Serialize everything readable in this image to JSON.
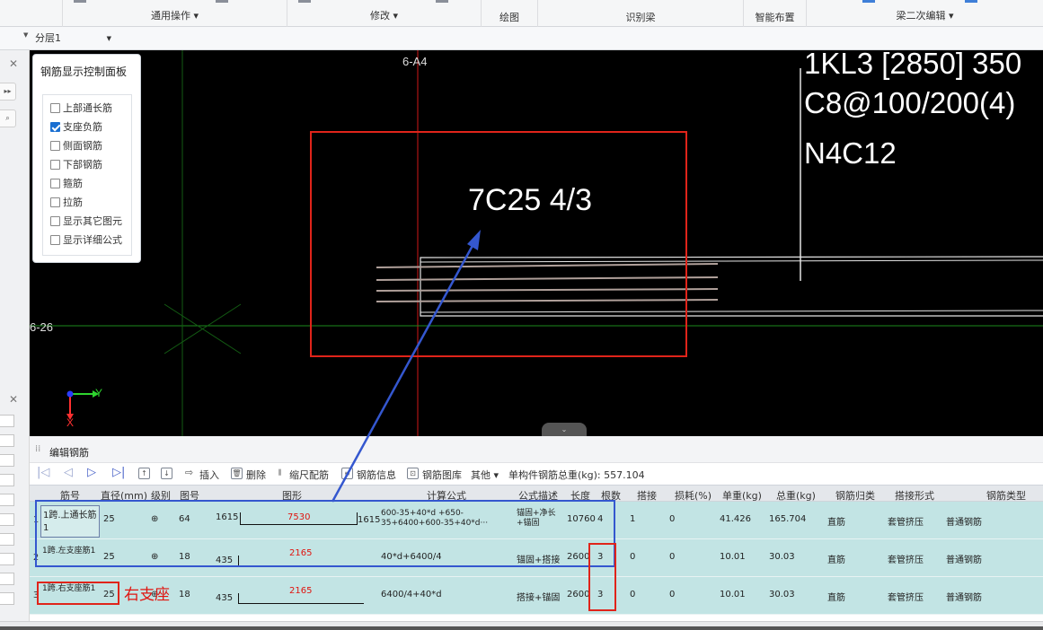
{
  "ribbon": {
    "groups": [
      {
        "label": "通用操作 ▾"
      },
      {
        "label": "修改 ▾"
      },
      {
        "label": "绘图"
      },
      {
        "label": "识别梁"
      },
      {
        "label": "智能布置"
      },
      {
        "label": "梁二次编辑 ▾"
      }
    ]
  },
  "subbar": {
    "layer": "分层1"
  },
  "canvas": {
    "annotation": "7C25 4/3",
    "beam_label_1": "1KL3 [2850] 350",
    "beam_label_2": "C8@100/200(4)",
    "beam_label_3": "N4C12",
    "axis_top": "6-A4",
    "axis_left": "6-26",
    "axis_y": "Y",
    "axis_x": "X",
    "collapse": "⌄"
  },
  "control_panel": {
    "title": "钢筋显示控制面板",
    "items": [
      {
        "label": "上部通长筋",
        "checked": false
      },
      {
        "label": "支座负筋",
        "checked": true
      },
      {
        "label": "侧面钢筋",
        "checked": false
      },
      {
        "label": "下部钢筋",
        "checked": false
      },
      {
        "label": "箍筋",
        "checked": false
      },
      {
        "label": "拉筋",
        "checked": false
      },
      {
        "label": "显示其它图元",
        "checked": false
      },
      {
        "label": "显示详细公式",
        "checked": false
      }
    ]
  },
  "edit_panel": {
    "title": "编辑钢筋",
    "toolbar": {
      "insert": "插入",
      "delete": "删除",
      "scale": "缩尺配筋",
      "info": "钢筋信息",
      "library": "钢筋图库",
      "other": "其他 ▾",
      "total": "单构件钢筋总重(kg): 557.104"
    },
    "columns": [
      "筋号",
      "直径(mm)",
      "级别",
      "图号",
      "图形",
      "计算公式",
      "公式描述",
      "长度",
      "根数",
      "搭接",
      "损耗(%)",
      "单重(kg)",
      "总重(kg)",
      "钢筋归类",
      "搭接形式",
      "钢筋类型"
    ],
    "rows": [
      {
        "num": "1",
        "name": "1跨.上通长筋1",
        "dia": "25",
        "grade": "⊕",
        "fig": "64",
        "shape_left": "1615",
        "shape_mid": "7530",
        "shape_right": "1615",
        "formula": "600-35+40*d +650-35+6400+600-35+40*d···",
        "desc": "锚固+净长+锚固",
        "length": "10760",
        "count": "4",
        "lap": "1",
        "loss": "0",
        "unit_w": "41.426",
        "total_w": "165.704",
        "class": "直筋",
        "lap_type": "套管挤压",
        "type": "普通钢筋"
      },
      {
        "num": "2",
        "name": "1跨.左支座筋1",
        "dia": "25",
        "grade": "⊕",
        "fig": "18",
        "shape_left": "435",
        "shape_mid": "2165",
        "shape_right": "",
        "formula": "40*d+6400/4",
        "desc": "锚固+搭接",
        "length": "2600",
        "count": "3",
        "lap": "0",
        "loss": "0",
        "unit_w": "10.01",
        "total_w": "30.03",
        "class": "直筋",
        "lap_type": "套管挤压",
        "type": "普通钢筋"
      },
      {
        "num": "3",
        "name": "1跨.右支座筋1",
        "dia": "25",
        "grade": "⊕",
        "fig": "18",
        "shape_left": "435",
        "shape_mid": "2165",
        "shape_right": "",
        "formula": "6400/4+40*d",
        "desc": "搭接+锚固",
        "length": "2600",
        "count": "3",
        "lap": "0",
        "loss": "0",
        "unit_w": "10.01",
        "total_w": "30.03",
        "class": "直筋",
        "lap_type": "套管挤压",
        "type": "普通钢筋"
      }
    ]
  },
  "note": {
    "right_seat": "右支座"
  },
  "colors": {
    "canvas_bg": "#000000",
    "row_bg": "#c2e4e4",
    "highlight_red": "#e0241a",
    "highlight_blue": "#3457cf",
    "checkbox_on": "#1a6fd1"
  }
}
